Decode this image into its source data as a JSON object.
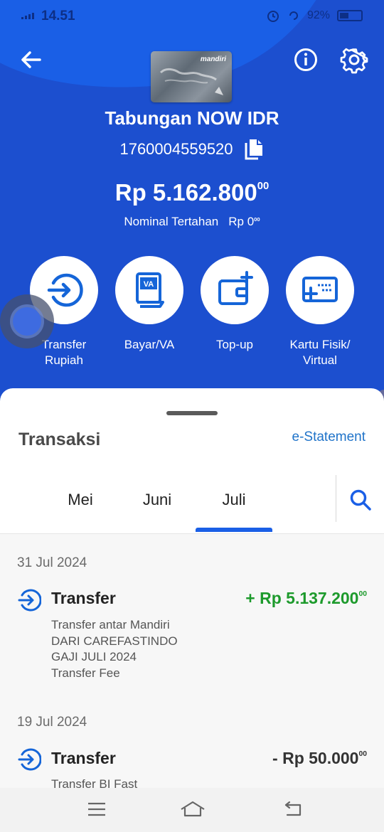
{
  "status_bar": {
    "time": "14.51",
    "battery": "92%"
  },
  "colors": {
    "header_blue": "#1c4fcf",
    "accent_blue": "#1a5fe6",
    "credit_green": "#1d9a2c",
    "link_blue": "#1f73c9"
  },
  "header": {
    "back_icon": "arrow-left-icon",
    "info_icon": "info-icon",
    "settings_icon": "gear-icon",
    "card_brand": "mandiri",
    "account_name": "Tabungan NOW IDR",
    "account_number": "1760004559520",
    "copy_icon": "copy-icon",
    "balance": {
      "main": "Rp 5.162.800",
      "decimals": "00"
    },
    "held": {
      "label": "Nominal Tertahan",
      "amount": "Rp 0",
      "decimals": "00"
    }
  },
  "actions": [
    {
      "label": "Transfer\nRupiah",
      "icon": "transfer-icon"
    },
    {
      "label": "Bayar/VA",
      "icon": "va-bill-icon"
    },
    {
      "label": "Top-up",
      "icon": "wallet-plus-icon"
    },
    {
      "label": "Kartu Fisik/\nVirtual",
      "icon": "card-add-icon"
    }
  ],
  "transactions_panel": {
    "title": "Transaksi",
    "estatement_link": "e-Statement",
    "tabs": [
      "Mei",
      "Juni",
      "Juli"
    ],
    "active_tab": "Juli",
    "search_icon": "search-icon",
    "groups": [
      {
        "date": "31 Jul 2024",
        "items": [
          {
            "title": "Transfer",
            "amount": "+ Rp 5.137.200",
            "decimals": "00",
            "type": "credit",
            "details": [
              "Transfer antar Mandiri",
              "DARI CAREFASTINDO",
              "GAJI JULI 2024",
              "Transfer Fee"
            ]
          }
        ]
      },
      {
        "date": "19 Jul 2024",
        "items": [
          {
            "title": "Transfer",
            "amount": "- Rp 50.000",
            "decimals": "00",
            "type": "debit",
            "details": [
              "Transfer BI Fast"
            ]
          }
        ]
      }
    ]
  },
  "nav_bar": {
    "icons": [
      "menu-icon",
      "home-icon",
      "back-icon"
    ]
  }
}
